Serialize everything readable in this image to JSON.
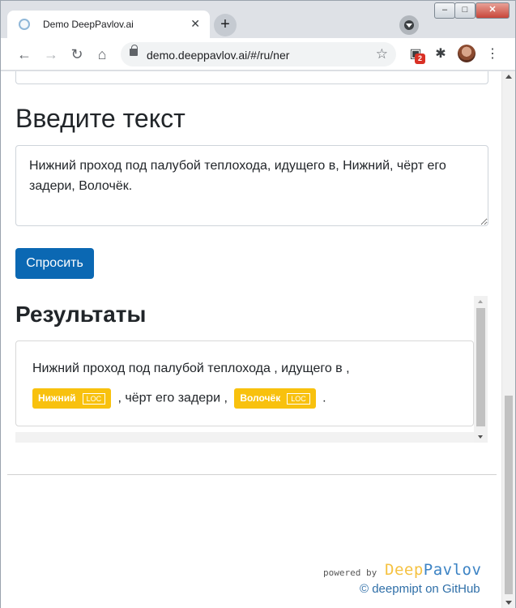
{
  "browser": {
    "tab_title": "Demo DeepPavlov.ai",
    "tab_close": "✕",
    "new_tab": "+",
    "url": "demo.deeppavlov.ai/#/ru/ner",
    "extension_badge": "2",
    "window_controls": {
      "minimize": "‒",
      "maximize": "□",
      "close": "✕"
    }
  },
  "page": {
    "input_heading": "Введите текст",
    "input_text": "Нижний проход под палубой теплохода, идущего в, Нижний, чёрт его задери, Волочёк.",
    "submit_label": "Спросить",
    "results_heading": "Результаты",
    "result": {
      "line1": "Нижний проход под палубой теплохода , идущего в ,",
      "entity1": {
        "text": "Нижний",
        "tag": "LOC"
      },
      "middle": ", чёрт его задери ,",
      "entity2": {
        "text": "Волочёк",
        "tag": "LOC"
      },
      "end": "."
    },
    "footer": {
      "powered_by": "powered by",
      "logo_deep": "Deep",
      "logo_pavlov": "Pavlov",
      "github_link": "© deepmipt on GitHub"
    }
  },
  "colors": {
    "accent_button": "#0b68b3",
    "entity_bg": "#f8c10e",
    "link": "#2f6fa8"
  }
}
